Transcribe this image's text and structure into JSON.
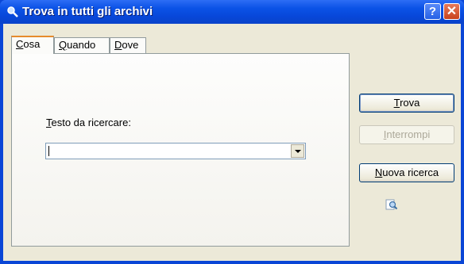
{
  "window": {
    "title": "Trova in tutti gli archivi"
  },
  "titlebar": {
    "help_label": "?",
    "close_label": "✕"
  },
  "tabs": [
    {
      "label_first": "C",
      "label_rest": "osa",
      "active": true
    },
    {
      "label_first": "Q",
      "label_rest": "uando",
      "active": false
    },
    {
      "label_first": "D",
      "label_rest": "ove",
      "active": false
    }
  ],
  "search": {
    "label_first": "T",
    "label_rest": "esto da ricercare:",
    "value": ""
  },
  "buttons": {
    "find_first": "T",
    "find_rest": "rova",
    "stop_first": "I",
    "stop_rest": "nterrompi",
    "new_first": "N",
    "new_rest": "uova ricerca"
  },
  "icons": {
    "title": "search-icon",
    "animation": "search-animation-icon"
  }
}
